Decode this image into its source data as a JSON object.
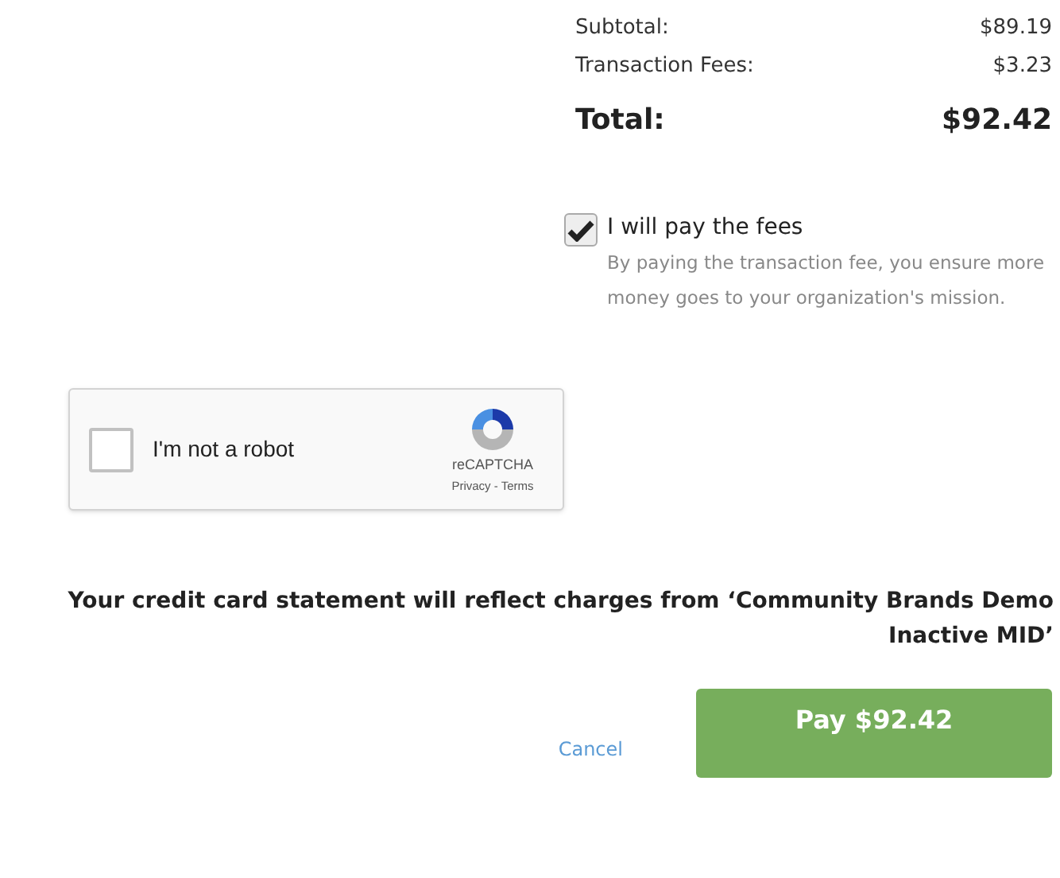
{
  "summary": {
    "rows": [
      {
        "label": "Subtotal:",
        "value": "$89.19"
      },
      {
        "label": "Transaction Fees:",
        "value": "$3.23"
      }
    ],
    "total": {
      "label": "Total:",
      "value": "$92.42"
    }
  },
  "fees_option": {
    "label": "I will pay the fees",
    "checked": true,
    "description": "By paying the transaction fee, you ensure more money goes to your organization's mission."
  },
  "captcha": {
    "label": "I'm not a robot",
    "checked": false,
    "brand": "reCAPTCHA",
    "links": "Privacy - Terms"
  },
  "statement": "Your credit card statement will reflect charges from ‘Community Brands Demo Inactive MID’",
  "buttons": {
    "cancel": "Cancel",
    "pay": "Pay $92.42"
  }
}
